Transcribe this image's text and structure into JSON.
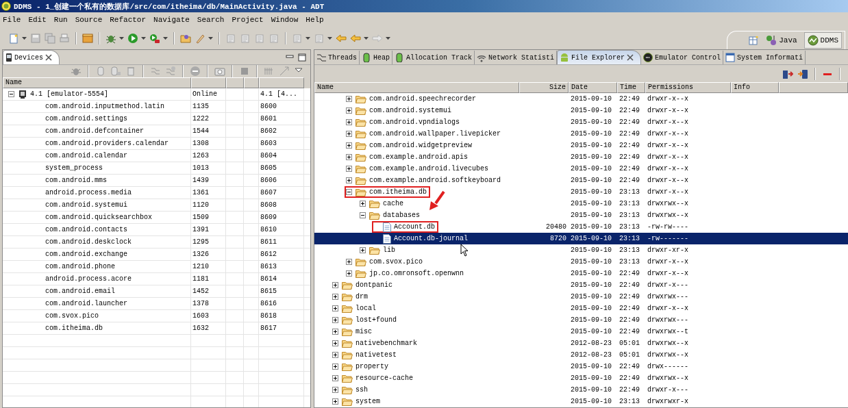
{
  "window": {
    "title": "DDMS - 1_创建一个私有的数据库/src/com/itheima/db/MainActivity.java - ADT"
  },
  "menu": [
    "File",
    "Edit",
    "Run",
    "Source",
    "Refactor",
    "Navigate",
    "Search",
    "Project",
    "Window",
    "Help"
  ],
  "perspectives": [
    {
      "label": "Java",
      "selected": false
    },
    {
      "label": "DDMS",
      "selected": true
    }
  ],
  "devices_view": {
    "tab": {
      "label": "Devices",
      "selected": true
    },
    "columns": [
      "Name"
    ],
    "device": {
      "name": "4.1 [emulator-5554]",
      "status": "Online",
      "column_5": "4.1 [4...",
      "expanded": true
    },
    "processes": [
      {
        "name": "com.android.inputmethod.latin",
        "pid": "1135",
        "port": "8600"
      },
      {
        "name": "com.android.settings",
        "pid": "1222",
        "port": "8601"
      },
      {
        "name": "com.android.defcontainer",
        "pid": "1544",
        "port": "8602"
      },
      {
        "name": "com.android.providers.calendar",
        "pid": "1308",
        "port": "8603"
      },
      {
        "name": "com.android.calendar",
        "pid": "1263",
        "port": "8604"
      },
      {
        "name": "system_process",
        "pid": "1013",
        "port": "8605"
      },
      {
        "name": "com.android.mms",
        "pid": "1439",
        "port": "8606"
      },
      {
        "name": "android.process.media",
        "pid": "1361",
        "port": "8607"
      },
      {
        "name": "com.android.systemui",
        "pid": "1120",
        "port": "8608"
      },
      {
        "name": "com.android.quicksearchbox",
        "pid": "1509",
        "port": "8609"
      },
      {
        "name": "com.android.contacts",
        "pid": "1391",
        "port": "8610"
      },
      {
        "name": "com.android.deskclock",
        "pid": "1295",
        "port": "8611"
      },
      {
        "name": "com.android.exchange",
        "pid": "1326",
        "port": "8612"
      },
      {
        "name": "com.android.phone",
        "pid": "1210",
        "port": "8613"
      },
      {
        "name": "android.process.acore",
        "pid": "1181",
        "port": "8614"
      },
      {
        "name": "com.android.email",
        "pid": "1452",
        "port": "8615"
      },
      {
        "name": "com.android.launcher",
        "pid": "1378",
        "port": "8616"
      },
      {
        "name": "com.svox.pico",
        "pid": "1603",
        "port": "8618"
      },
      {
        "name": "com.itheima.db",
        "pid": "1632",
        "port": "8617"
      }
    ]
  },
  "tool_tabs": [
    {
      "label": "Threads",
      "selected": false,
      "kind": "threads"
    },
    {
      "label": "Heap",
      "selected": false,
      "kind": "heap"
    },
    {
      "label": "Allocation Track",
      "selected": false,
      "kind": "heap"
    },
    {
      "label": "Network Statisti",
      "selected": false,
      "kind": "network"
    },
    {
      "label": "File Explorer",
      "selected": true,
      "kind": "android"
    },
    {
      "label": "Emulator Control",
      "selected": false,
      "kind": "emulator"
    },
    {
      "label": "System Informati",
      "selected": false,
      "kind": "window"
    }
  ],
  "file_explorer": {
    "columns": [
      "Name",
      "Size",
      "Date",
      "Time",
      "Permissions",
      "Info"
    ],
    "continued_children": [
      {
        "kind": "folder",
        "name": "com.android.speechrecorder",
        "date": "2015-09-10",
        "time": "22:49",
        "permissions": "drwxr-x--x",
        "expanded": false,
        "selected": false,
        "highlighted": false
      },
      {
        "kind": "folder",
        "name": "com.android.systemui",
        "date": "2015-09-10",
        "time": "22:49",
        "permissions": "drwxr-x--x",
        "expanded": false,
        "selected": false,
        "highlighted": false
      },
      {
        "kind": "folder",
        "name": "com.android.vpndialogs",
        "date": "2015-09-10",
        "time": "22:49",
        "permissions": "drwxr-x--x",
        "expanded": false,
        "selected": false,
        "highlighted": false
      },
      {
        "kind": "folder",
        "name": "com.android.wallpaper.livepicker",
        "date": "2015-09-10",
        "time": "22:49",
        "permissions": "drwxr-x--x",
        "expanded": false,
        "selected": false,
        "highlighted": false
      },
      {
        "kind": "folder",
        "name": "com.android.widgetpreview",
        "date": "2015-09-10",
        "time": "22:49",
        "permissions": "drwxr-x--x",
        "expanded": false,
        "selected": false,
        "highlighted": false
      },
      {
        "kind": "folder",
        "name": "com.example.android.apis",
        "date": "2015-09-10",
        "time": "22:49",
        "permissions": "drwxr-x--x",
        "expanded": false,
        "selected": false,
        "highlighted": false
      },
      {
        "kind": "folder",
        "name": "com.example.android.livecubes",
        "date": "2015-09-10",
        "time": "22:49",
        "permissions": "drwxr-x--x",
        "expanded": false,
        "selected": false,
        "highlighted": false
      },
      {
        "kind": "folder",
        "name": "com.example.android.softkeyboard",
        "date": "2015-09-10",
        "time": "22:49",
        "permissions": "drwxr-x--x",
        "expanded": false,
        "selected": false,
        "highlighted": false
      },
      {
        "kind": "folder",
        "name": "com.itheima.db",
        "date": "2015-09-10",
        "time": "23:13",
        "permissions": "drwxr-x--x",
        "expanded": true,
        "selected": false,
        "highlighted": true,
        "children": [
          {
            "kind": "folder",
            "name": "cache",
            "date": "2015-09-10",
            "time": "23:13",
            "permissions": "drwxrwx--x",
            "expanded": false,
            "selected": false,
            "highlighted": false
          },
          {
            "kind": "folder",
            "name": "databases",
            "date": "2015-09-10",
            "time": "23:13",
            "permissions": "drwxrwx--x",
            "expanded": true,
            "selected": false,
            "highlighted": false,
            "children": [
              {
                "kind": "file",
                "name": "Account.db",
                "size": "20480",
                "date": "2015-09-10",
                "time": "23:13",
                "permissions": "-rw-rw----",
                "selected": false,
                "highlighted": true
              },
              {
                "kind": "file",
                "name": "Account.db-journal",
                "size": "8720",
                "date": "2015-09-10",
                "time": "23:13",
                "permissions": "-rw-------",
                "selected": true,
                "highlighted": false
              }
            ]
          },
          {
            "kind": "folder",
            "name": "lib",
            "date": "2015-09-10",
            "time": "23:13",
            "permissions": "drwxr-xr-x",
            "expanded": false,
            "selected": false,
            "highlighted": false
          }
        ]
      },
      {
        "kind": "folder",
        "name": "com.svox.pico",
        "date": "2015-09-10",
        "time": "23:13",
        "permissions": "drwxr-x--x",
        "expanded": false,
        "selected": false,
        "highlighted": false
      },
      {
        "kind": "folder",
        "name": "jp.co.omronsoft.openwnn",
        "date": "2015-09-10",
        "time": "22:49",
        "permissions": "drwxr-x--x",
        "expanded": false,
        "selected": false,
        "highlighted": false
      }
    ],
    "items": [
      {
        "kind": "folder",
        "name": "dontpanic",
        "date": "2015-09-10",
        "time": "22:49",
        "permissions": "drwxr-x---",
        "expanded": false,
        "selected": false,
        "highlighted": false
      },
      {
        "kind": "folder",
        "name": "drm",
        "date": "2015-09-10",
        "time": "22:49",
        "permissions": "drwxrwx---",
        "expanded": false,
        "selected": false,
        "highlighted": false
      },
      {
        "kind": "folder",
        "name": "local",
        "date": "2015-09-10",
        "time": "22:49",
        "permissions": "drwxr-x--x",
        "expanded": false,
        "selected": false,
        "highlighted": false
      },
      {
        "kind": "folder",
        "name": "lost+found",
        "date": "2015-09-10",
        "time": "22:49",
        "permissions": "drwxrwx---",
        "expanded": false,
        "selected": false,
        "highlighted": false
      },
      {
        "kind": "folder",
        "name": "misc",
        "date": "2015-09-10",
        "time": "22:49",
        "permissions": "drwxrwx--t",
        "expanded": false,
        "selected": false,
        "highlighted": false
      },
      {
        "kind": "folder",
        "name": "nativebenchmark",
        "date": "2012-08-23",
        "time": "05:01",
        "permissions": "drwxrwx--x",
        "expanded": false,
        "selected": false,
        "highlighted": false
      },
      {
        "kind": "folder",
        "name": "nativetest",
        "date": "2012-08-23",
        "time": "05:01",
        "permissions": "drwxrwx--x",
        "expanded": false,
        "selected": false,
        "highlighted": false
      },
      {
        "kind": "folder",
        "name": "property",
        "date": "2015-09-10",
        "time": "22:49",
        "permissions": "drwx------",
        "expanded": false,
        "selected": false,
        "highlighted": false
      },
      {
        "kind": "folder",
        "name": "resource-cache",
        "date": "2015-09-10",
        "time": "22:49",
        "permissions": "drwxrwx--x",
        "expanded": false,
        "selected": false,
        "highlighted": false
      },
      {
        "kind": "folder",
        "name": "ssh",
        "date": "2015-09-10",
        "time": "22:49",
        "permissions": "drwxr-x---",
        "expanded": false,
        "selected": false,
        "highlighted": false
      },
      {
        "kind": "folder",
        "name": "system",
        "date": "2015-09-10",
        "time": "23:13",
        "permissions": "drwxrwxr-x",
        "expanded": false,
        "selected": false,
        "highlighted": false
      }
    ]
  }
}
